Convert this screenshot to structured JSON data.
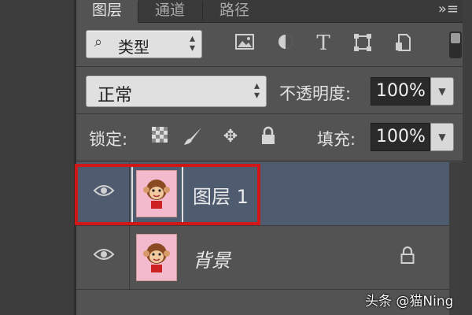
{
  "tabs": [
    {
      "label": "图层",
      "active": true
    },
    {
      "label": "通道",
      "active": false
    },
    {
      "label": "路径",
      "active": false
    }
  ],
  "panel_menu_icon": "panel-menu-icon",
  "filter": {
    "search_icon": "search-icon",
    "label": "类型",
    "icons": [
      "pixel-filter-icon",
      "adjustment-filter-icon",
      "type-filter-icon",
      "shape-filter-icon",
      "smart-object-filter-icon"
    ]
  },
  "blend": {
    "mode": "正常",
    "opacity_label": "不透明度:",
    "opacity_value": "100%"
  },
  "lock": {
    "label": "锁定:",
    "icons": [
      "lock-transparent-pixels-icon",
      "lock-image-pixels-icon",
      "lock-position-icon",
      "lock-all-icon"
    ],
    "fill_label": "填充:",
    "fill_value": "100%"
  },
  "layers": [
    {
      "name": "图层 1",
      "selected": true,
      "visible": true,
      "locked": false
    },
    {
      "name": "背景",
      "selected": false,
      "visible": true,
      "locked": true
    }
  ],
  "watermark": "头条 @猫Ning",
  "colors": {
    "panel_bg": "#535353",
    "selected_layer": "#4f5c70",
    "highlight": "#d01818",
    "thumbnail_bg": "#f3b9cc"
  }
}
